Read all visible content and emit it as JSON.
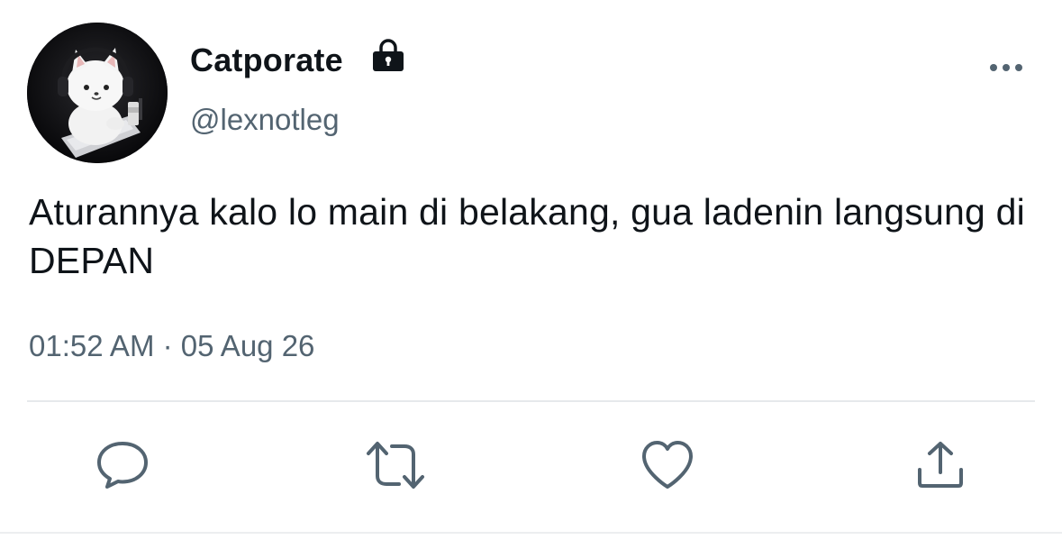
{
  "tweet": {
    "display_name": "Catporate",
    "handle": "@lexnotleg",
    "protected_icon": "lock-icon",
    "text": "Aturannya kalo lo main di belakang, gua ladenin langsung di DEPAN",
    "timestamp": "01:52 AM · 05 Aug 26"
  },
  "actions": [
    {
      "icon": "reply-icon"
    },
    {
      "icon": "retweet-icon"
    },
    {
      "icon": "like-icon"
    },
    {
      "icon": "share-icon"
    }
  ],
  "menu_icon": "more-options-icon",
  "colors": {
    "text": "#0f1419",
    "secondary": "#536471",
    "divider": "#e6e9ec"
  }
}
